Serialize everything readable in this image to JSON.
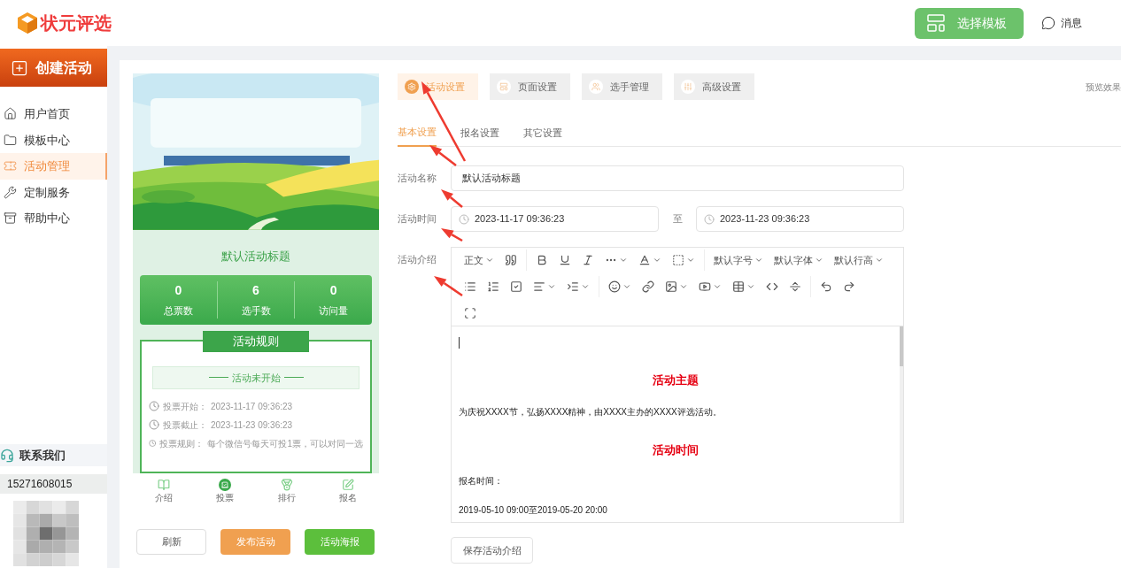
{
  "logo": {
    "text": "状元评选"
  },
  "header": {
    "template_button": "选择模板",
    "messages": "消息"
  },
  "sidebar": {
    "create_button": "创建活动",
    "items": [
      {
        "label": "用户首页",
        "selected": false
      },
      {
        "label": "模板中心",
        "selected": false
      },
      {
        "label": "活动管理",
        "selected": true
      },
      {
        "label": "定制服务",
        "selected": false
      },
      {
        "label": "帮助中心",
        "selected": false
      }
    ],
    "contact": {
      "title": "联系我们",
      "phone": "15271608015"
    }
  },
  "preview": {
    "title": "默认活动标题",
    "stats": [
      {
        "value": "0",
        "label": "总票数"
      },
      {
        "value": "6",
        "label": "选手数"
      },
      {
        "value": "0",
        "label": "访问量"
      }
    ],
    "rules_title": "活动规则",
    "status": "活动未开始",
    "rules": [
      {
        "label": "投票开始：",
        "value": "2023-11-17 09:36:23"
      },
      {
        "label": "投票截止：",
        "value": "2023-11-23 09:36:23"
      },
      {
        "label": "投票规则：",
        "value": "每个微信号每天可投1票，可以对同一选"
      }
    ],
    "nav": [
      {
        "label": "介绍",
        "selected": false
      },
      {
        "label": "投票",
        "selected": true
      },
      {
        "label": "排行",
        "selected": false
      },
      {
        "label": "报名",
        "selected": false
      }
    ],
    "buttons": [
      {
        "label": "刷新",
        "kind": "plain"
      },
      {
        "label": "发布活动",
        "kind": "orange"
      },
      {
        "label": "活动海报",
        "kind": "green"
      }
    ]
  },
  "top_tabs": [
    {
      "label": "活动设置",
      "selected": true
    },
    {
      "label": "页面设置",
      "selected": false
    },
    {
      "label": "选手管理",
      "selected": false
    },
    {
      "label": "高级设置",
      "selected": false
    }
  ],
  "preview_link": "预览效果",
  "sub_tabs": [
    {
      "label": "基本设置",
      "selected": true
    },
    {
      "label": "报名设置",
      "selected": false
    },
    {
      "label": "其它设置",
      "selected": false
    }
  ],
  "form": {
    "name_label": "活动名称",
    "name_value": "默认活动标题",
    "time_label": "活动时间",
    "start": "2023-11-17 09:36:23",
    "separator": "至",
    "end": "2023-11-23 09:36:23",
    "intro_label": "活动介绍"
  },
  "editor": {
    "toolbar_labels": [
      "正文",
      "默认字号",
      "默认字体",
      "默认行高"
    ],
    "content": [
      {
        "kind": "heading",
        "text": "活动主题"
      },
      {
        "kind": "paragraph",
        "text": "为庆祝XXXX节，弘扬XXXX精神，由XXXX主办的XXXX评选活动。"
      },
      {
        "kind": "heading",
        "text": "活动时间"
      },
      {
        "kind": "paragraph",
        "text": "报名时间："
      },
      {
        "kind": "paragraph",
        "text": "2019-05-10 09:00至2019-05-20 20:00"
      }
    ],
    "save_button": "保存活动介绍"
  }
}
